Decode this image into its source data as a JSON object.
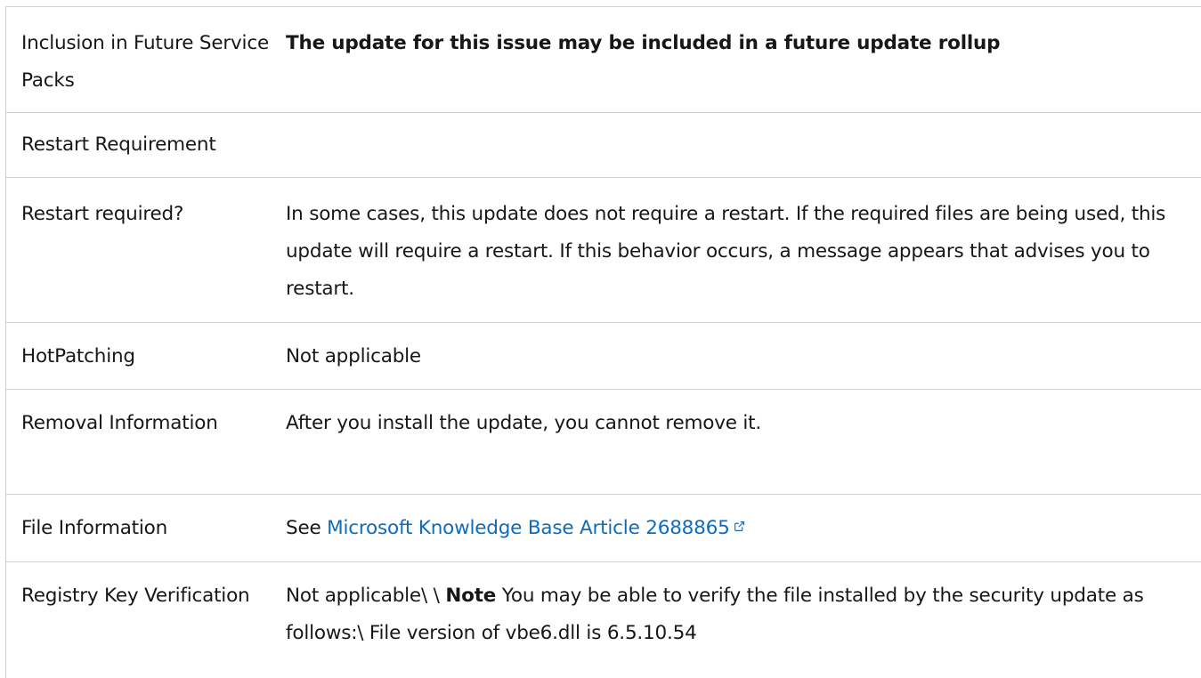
{
  "rows": {
    "future_sp": {
      "label": "Inclusion in Future Service Packs",
      "value": "The update for this issue may be included in a future update rollup"
    },
    "restart_req_header": {
      "label": "Restart Requirement"
    },
    "restart_required": {
      "label": "Restart required?",
      "value": "In some cases, this update does not require a restart. If the required files are being used, this update will require a restart. If this behavior occurs, a message appears that advises you to restart."
    },
    "hotpatching": {
      "label": "HotPatching",
      "value": "Not applicable"
    },
    "removal": {
      "label": "Removal Information",
      "value": "After you install the update, you cannot remove it."
    },
    "file_info": {
      "label": "File Information",
      "value_prefix": "See ",
      "link_text": "Microsoft Knowledge Base Article 2688865"
    },
    "registry": {
      "label": "Registry Key Verification",
      "value_prefix": "Not applicable\\ \\ ",
      "note_label": "Note",
      "value_suffix": " You may be able to verify the file installed by the security update as follows:\\ File version of vbe6.dll is 6.5.10.54"
    }
  },
  "colors": {
    "link": "#0f6cbd",
    "border": "#d1d1d1",
    "text": "#171717"
  },
  "icons": {
    "external_link": "external-link-icon"
  }
}
